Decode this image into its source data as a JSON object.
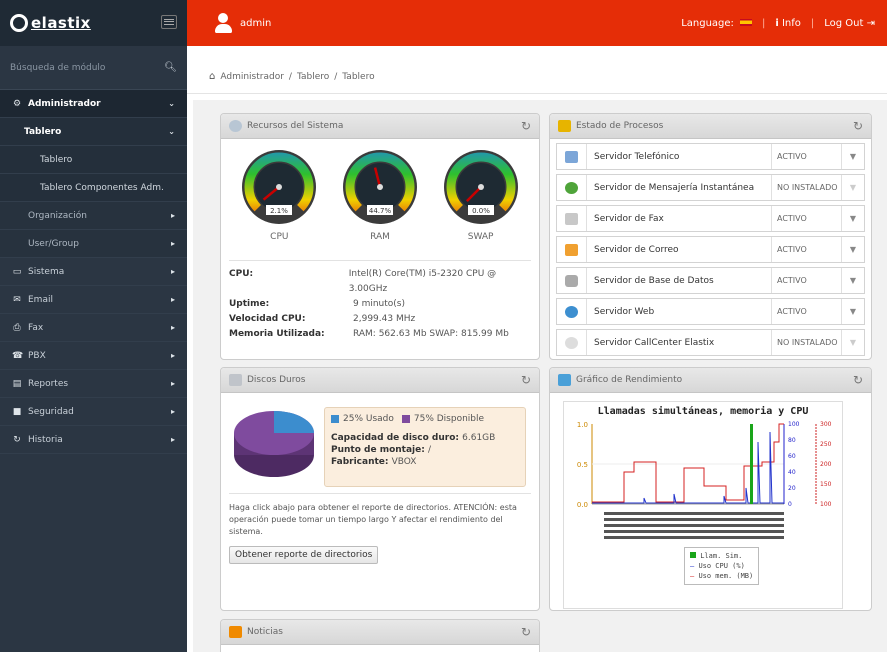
{
  "app": {
    "logo": "elastix"
  },
  "sidebar": {
    "search_placeholder": "Búsqueda de módulo",
    "items": [
      {
        "label": "Administrador",
        "icon": "gear-icon",
        "chev": "⌄"
      },
      {
        "label": "Tablero",
        "chev": "⌄"
      },
      {
        "label": "Tablero"
      },
      {
        "label": "Tablero Componentes Adm."
      },
      {
        "label": "Organización",
        "chev": "›"
      },
      {
        "label": "User/Group",
        "chev": "›"
      },
      {
        "label": "Sistema",
        "icon": "monitor-icon",
        "chev": "›"
      },
      {
        "label": "Email",
        "icon": "envelope-icon",
        "chev": "›"
      },
      {
        "label": "Fax",
        "icon": "printer-icon",
        "chev": "›"
      },
      {
        "label": "PBX",
        "icon": "phone-icon",
        "chev": "›"
      },
      {
        "label": "Reportes",
        "icon": "report-icon",
        "chev": "›"
      },
      {
        "label": "Seguridad",
        "icon": "lock-icon",
        "chev": "›"
      },
      {
        "label": "Historia",
        "icon": "history-icon",
        "chev": "›"
      }
    ]
  },
  "topbar": {
    "user": "admin",
    "language_label": "Language:",
    "info_label": "Info",
    "logout_label": "Log Out"
  },
  "breadcrumb": [
    "Administrador",
    "Tablero",
    "Tablero"
  ],
  "recursos": {
    "title": "Recursos del Sistema",
    "gauges": [
      {
        "name": "CPU",
        "value": "2.1%",
        "pct": 2.1
      },
      {
        "name": "RAM",
        "value": "44.7%",
        "pct": 44.7
      },
      {
        "name": "SWAP",
        "value": "0.0%",
        "pct": 0.0
      }
    ],
    "info": [
      {
        "k": "CPU:",
        "v": "Intel(R) Core(TM) i5-2320 CPU @ 3.00GHz"
      },
      {
        "k": "Uptime:",
        "v": "9 minuto(s)"
      },
      {
        "k": "Velocidad CPU:",
        "v": "2,999.43 MHz"
      },
      {
        "k": "Memoria Utilizada:",
        "v": "RAM: 562.63 Mb SWAP: 815.99 Mb"
      }
    ]
  },
  "procesos": {
    "title": "Estado de Procesos",
    "items": [
      {
        "name": "Servidor Telefónico",
        "status": "ACTIVO",
        "icon": "phone-icon"
      },
      {
        "name": "Servidor de Mensajería Instantánea",
        "status": "NO INSTALADO",
        "icon": "chat-icon"
      },
      {
        "name": "Servidor de Fax",
        "status": "ACTIVO",
        "icon": "fax-icon"
      },
      {
        "name": "Servidor de Correo",
        "status": "ACTIVO",
        "icon": "mail-icon"
      },
      {
        "name": "Servidor de Base de Datos",
        "status": "ACTIVO",
        "icon": "database-icon"
      },
      {
        "name": "Servidor Web",
        "status": "ACTIVO",
        "icon": "globe-icon"
      },
      {
        "name": "Servidor CallCenter Elastix",
        "status": "NO INSTALADO",
        "icon": "headset-icon"
      }
    ]
  },
  "discos": {
    "title": "Discos Duros",
    "used_label": "25% Usado",
    "free_label": "75% Disponible",
    "used_pct": 25,
    "capacity_label": "Capacidad de disco duro:",
    "capacity_value": "6.61GB",
    "mount_label": "Punto de montaje:",
    "mount_value": "/",
    "vendor_label": "Fabricante:",
    "vendor_value": "VBOX",
    "note": "Haga click abajo para obtener el reporte de directorios. ATENCIÓN: esta operación puede tomar un tiempo largo Y afectar el rendimiento del sistema.",
    "button_label": "Obtener reporte de directorios"
  },
  "rendimiento": {
    "title": "Gráfico de Rendimiento",
    "legend": [
      "Llam. Sim.",
      "Uso CPU (%)",
      "Uso mem. (MB)"
    ]
  },
  "noticias": {
    "title": "Noticias"
  },
  "colors": {
    "topbar": "#e52d07",
    "sidebar": "#2b3643",
    "used": "#3c8dce",
    "free": "#7f4b9e"
  },
  "chart_data": {
    "type": "line",
    "title": "Llamadas simultáneas, memoria y CPU",
    "y_left_ticks": [
      "1.0",
      "0.5",
      "0.0"
    ],
    "y_mid_ticks": [
      "100",
      "80",
      "60",
      "40",
      "20",
      "0"
    ],
    "y_right_ticks": [
      "300",
      "250",
      "200",
      "150",
      "100"
    ],
    "series": [
      {
        "name": "Llam. Sim.",
        "color": "#1aa51a"
      },
      {
        "name": "Uso CPU (%)",
        "color": "#2233cc"
      },
      {
        "name": "Uso mem. (MB)",
        "color": "#d42020"
      }
    ]
  }
}
